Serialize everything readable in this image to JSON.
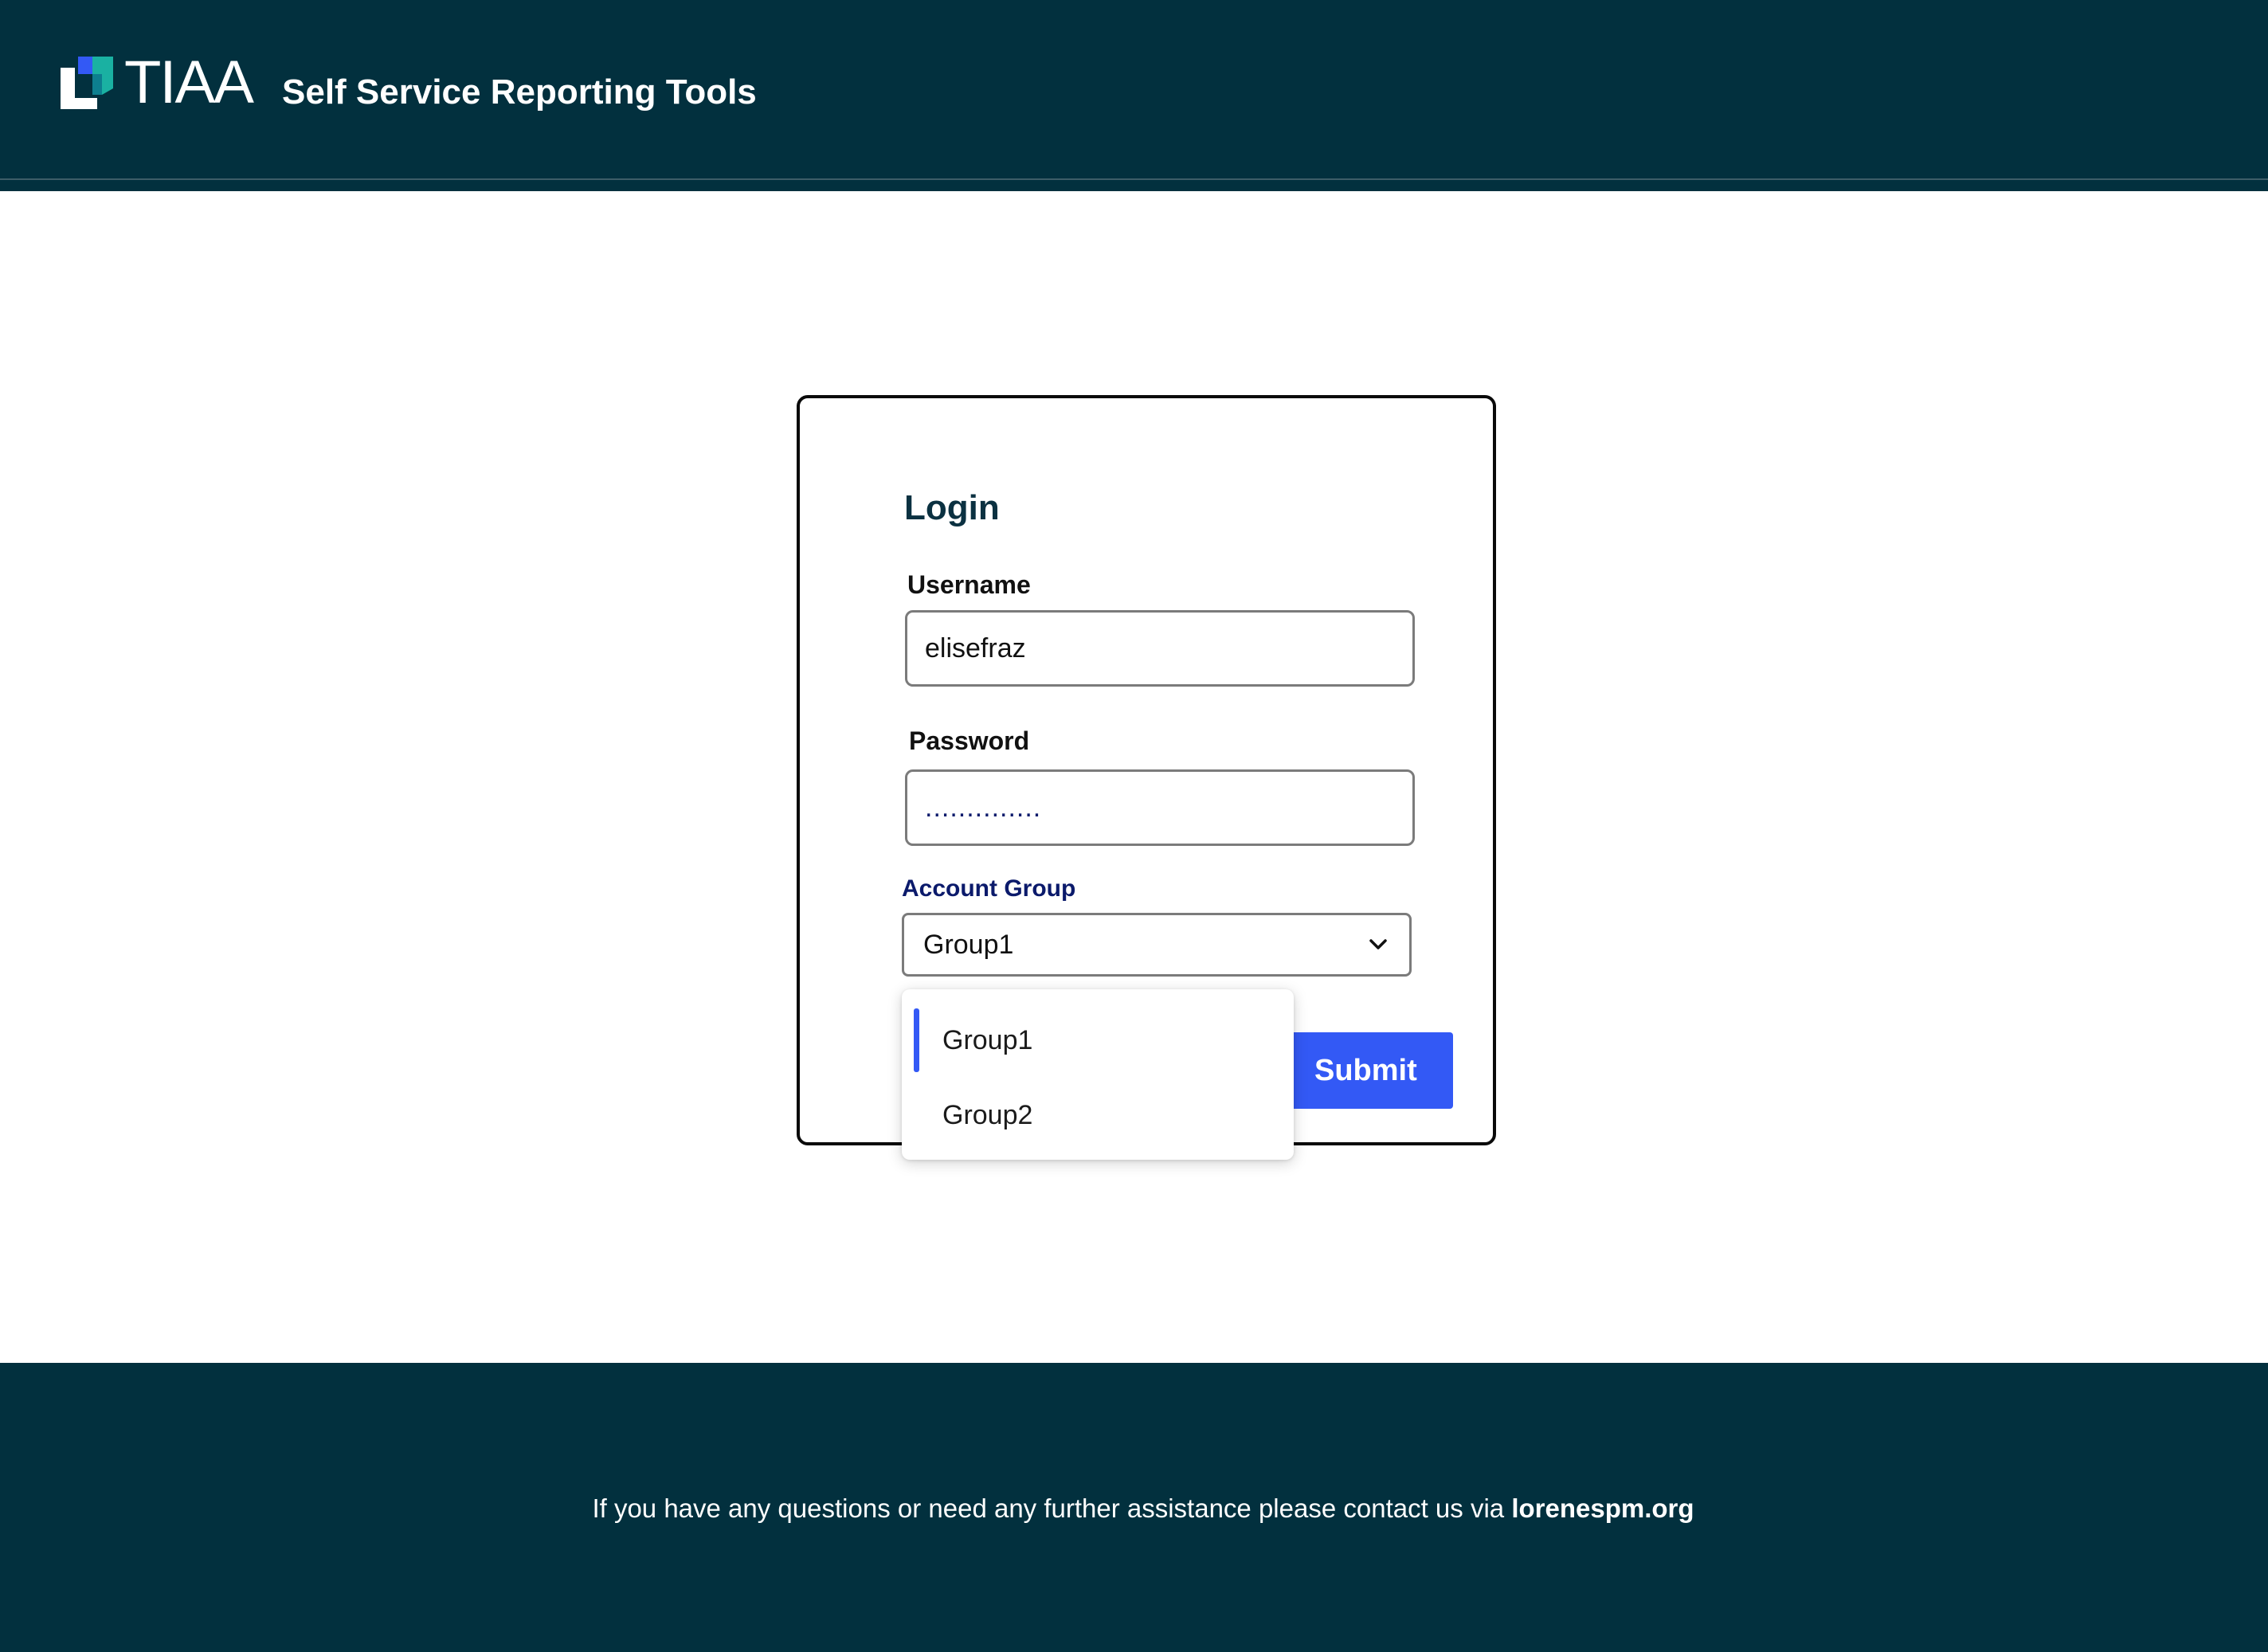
{
  "header": {
    "logo_text": "TIAA",
    "app_title": "Self Service Reporting Tools",
    "background_color": "#02303e"
  },
  "login": {
    "title": "Login",
    "username_label": "Username",
    "username_value": "elisefraz",
    "password_label": "Password",
    "password_value": "..............",
    "account_group_label": "Account Group",
    "account_group_selected": "Group1",
    "account_group_options": [
      "Group1",
      "Group2"
    ],
    "submit_label": "Submit",
    "accent_color": "#3359f5"
  },
  "footer": {
    "message": "If you have any questions or need any further assistance please contact us via",
    "link_text": "lorenespm.org"
  }
}
